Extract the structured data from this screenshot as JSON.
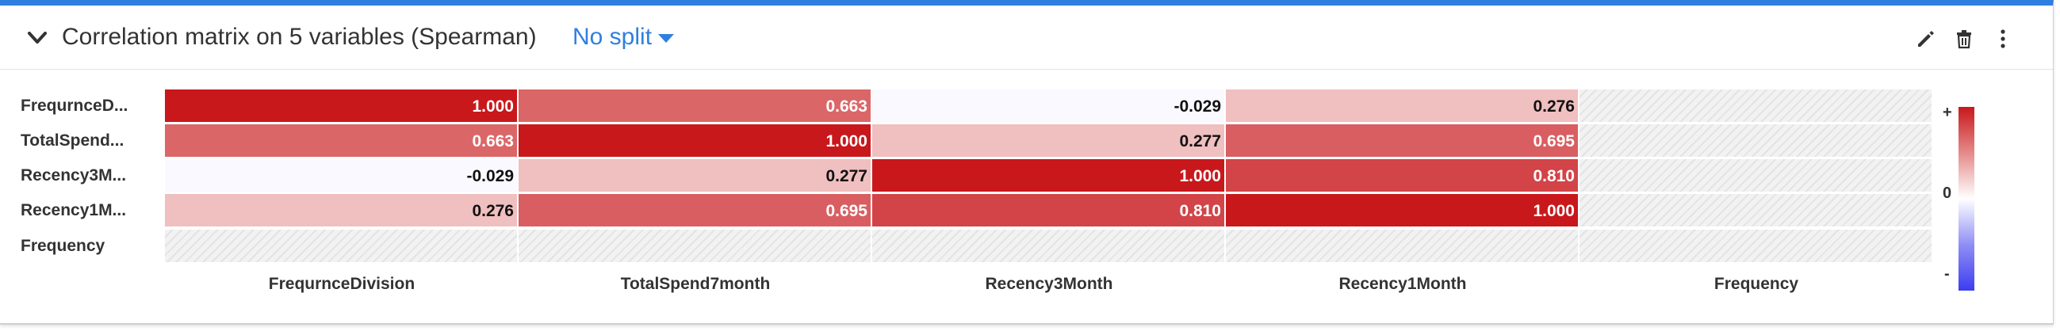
{
  "header": {
    "title": "Correlation matrix on 5 variables (Spearman)",
    "split_label": "No split",
    "icons": [
      "chevron-down-icon",
      "pencil-icon",
      "trash-icon",
      "more-vertical-icon"
    ]
  },
  "matrix": {
    "row_labels": [
      "FrequrnceD...",
      "TotalSpend...",
      "Recency3M...",
      "Recency1M...",
      "Frequency"
    ],
    "col_labels": [
      "FrequrnceDivision",
      "TotalSpend7month",
      "Recency3Month",
      "Recency1Month",
      "Frequency"
    ],
    "values": [
      [
        "1.000",
        "0.663",
        "-0.029",
        "0.276",
        ""
      ],
      [
        "0.663",
        "1.000",
        "0.277",
        "0.695",
        ""
      ],
      [
        "-0.029",
        "0.277",
        "1.000",
        "0.810",
        ""
      ],
      [
        "0.276",
        "0.695",
        "0.810",
        "1.000",
        ""
      ],
      [
        "",
        "",
        "",
        "",
        ""
      ]
    ]
  },
  "chart_data": {
    "type": "heatmap",
    "title": "Correlation matrix on 5 variables (Spearman)",
    "x": [
      "FrequrnceDivision",
      "TotalSpend7month",
      "Recency3Month",
      "Recency1Month",
      "Frequency"
    ],
    "y": [
      "FrequrnceD...",
      "TotalSpend...",
      "Recency3M...",
      "Recency1M...",
      "Frequency"
    ],
    "z": [
      [
        1.0,
        0.663,
        -0.029,
        0.276,
        null
      ],
      [
        0.663,
        1.0,
        0.277,
        0.695,
        null
      ],
      [
        -0.029,
        0.277,
        1.0,
        0.81,
        null
      ],
      [
        0.276,
        0.695,
        0.81,
        1.0,
        null
      ],
      [
        null,
        null,
        null,
        null,
        null
      ]
    ],
    "zlim": [
      -1,
      1
    ],
    "colors": {
      "positive": "#c8181c",
      "neutral": "#ffffff",
      "negative": "#3d3df0"
    }
  },
  "legend": {
    "plus": "+",
    "zero": "0",
    "minus": "-"
  },
  "colors": {
    "accent": "#2f7fdf"
  }
}
